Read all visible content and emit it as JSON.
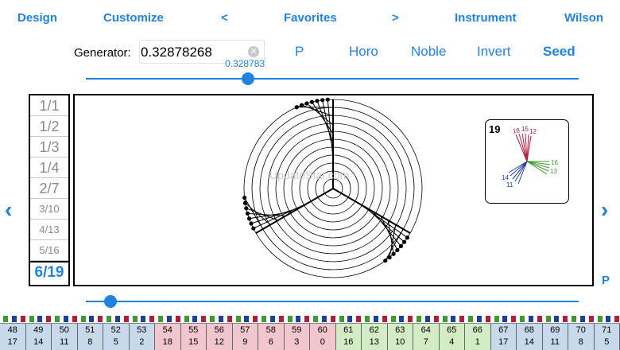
{
  "nav": {
    "design": "Design",
    "customize": "Customize",
    "prev": "<",
    "favorites": "Favorites",
    "next": ">",
    "instrument": "Instrument",
    "wilson": "Wilson"
  },
  "generator": {
    "label": "Generator:",
    "value": "0.32878268",
    "slider_value": "0.328783",
    "slider_fraction": 0.328783
  },
  "modes": {
    "p": "P",
    "horo": "Horo",
    "noble": "Noble",
    "invert": "Invert",
    "seed": "Seed"
  },
  "ratios": [
    {
      "label": "1/1"
    },
    {
      "label": "1/2"
    },
    {
      "label": "1/3"
    },
    {
      "label": "1/4"
    },
    {
      "label": "2/7"
    },
    {
      "label": "3/10"
    },
    {
      "label": "4/13"
    },
    {
      "label": "5/16"
    },
    {
      "label": "6/19"
    }
  ],
  "selected_ratio": "6/19",
  "mini_plot": {
    "count": "19",
    "labels_red": "18",
    "labels_red2": "15",
    "labels_red3": "12",
    "labels_green": "16",
    "labels_green2": "13",
    "labels_blue": "14",
    "labels_blue2": "11"
  },
  "watermark": "UpdateStar.com",
  "side_arrows": {
    "left": "‹",
    "right": "›"
  },
  "corner_p": "P",
  "bottom_slider_fraction": 0.05,
  "keyboard": [
    {
      "top": "48",
      "bottom": "17",
      "color": "#c9d9ec"
    },
    {
      "top": "49",
      "bottom": "14",
      "color": "#c9d9ec"
    },
    {
      "top": "50",
      "bottom": "11",
      "color": "#c9d9ec"
    },
    {
      "top": "51",
      "bottom": "8",
      "color": "#c9d9ec"
    },
    {
      "top": "52",
      "bottom": "5",
      "color": "#c9d9ec"
    },
    {
      "top": "53",
      "bottom": "2",
      "color": "#c9d9ec"
    },
    {
      "top": "54",
      "bottom": "18",
      "color": "#f2c6cf"
    },
    {
      "top": "55",
      "bottom": "15",
      "color": "#f2c6cf"
    },
    {
      "top": "56",
      "bottom": "12",
      "color": "#f2c6cf"
    },
    {
      "top": "57",
      "bottom": "9",
      "color": "#f2c6cf"
    },
    {
      "top": "58",
      "bottom": "6",
      "color": "#f2c6cf"
    },
    {
      "top": "59",
      "bottom": "3",
      "color": "#f2c6cf"
    },
    {
      "top": "60",
      "bottom": "0",
      "color": "#f2c6cf"
    },
    {
      "top": "61",
      "bottom": "16",
      "color": "#d4ecc6"
    },
    {
      "top": "62",
      "bottom": "13",
      "color": "#d4ecc6"
    },
    {
      "top": "63",
      "bottom": "10",
      "color": "#d4ecc6"
    },
    {
      "top": "64",
      "bottom": "7",
      "color": "#d4ecc6"
    },
    {
      "top": "65",
      "bottom": "4",
      "color": "#d4ecc6"
    },
    {
      "top": "66",
      "bottom": "1",
      "color": "#d4ecc6"
    },
    {
      "top": "67",
      "bottom": "17",
      "color": "#c9d9ec"
    },
    {
      "top": "68",
      "bottom": "14",
      "color": "#c9d9ec"
    },
    {
      "top": "69",
      "bottom": "11",
      "color": "#c9d9ec"
    },
    {
      "top": "70",
      "bottom": "8",
      "color": "#c9d9ec"
    },
    {
      "top": "71",
      "bottom": "5",
      "color": "#c9d9ec"
    }
  ],
  "colors": {
    "accent": "#2183e0",
    "red": "#b01e3c",
    "green": "#3f9a2f",
    "blue": "#1c3fa0"
  }
}
